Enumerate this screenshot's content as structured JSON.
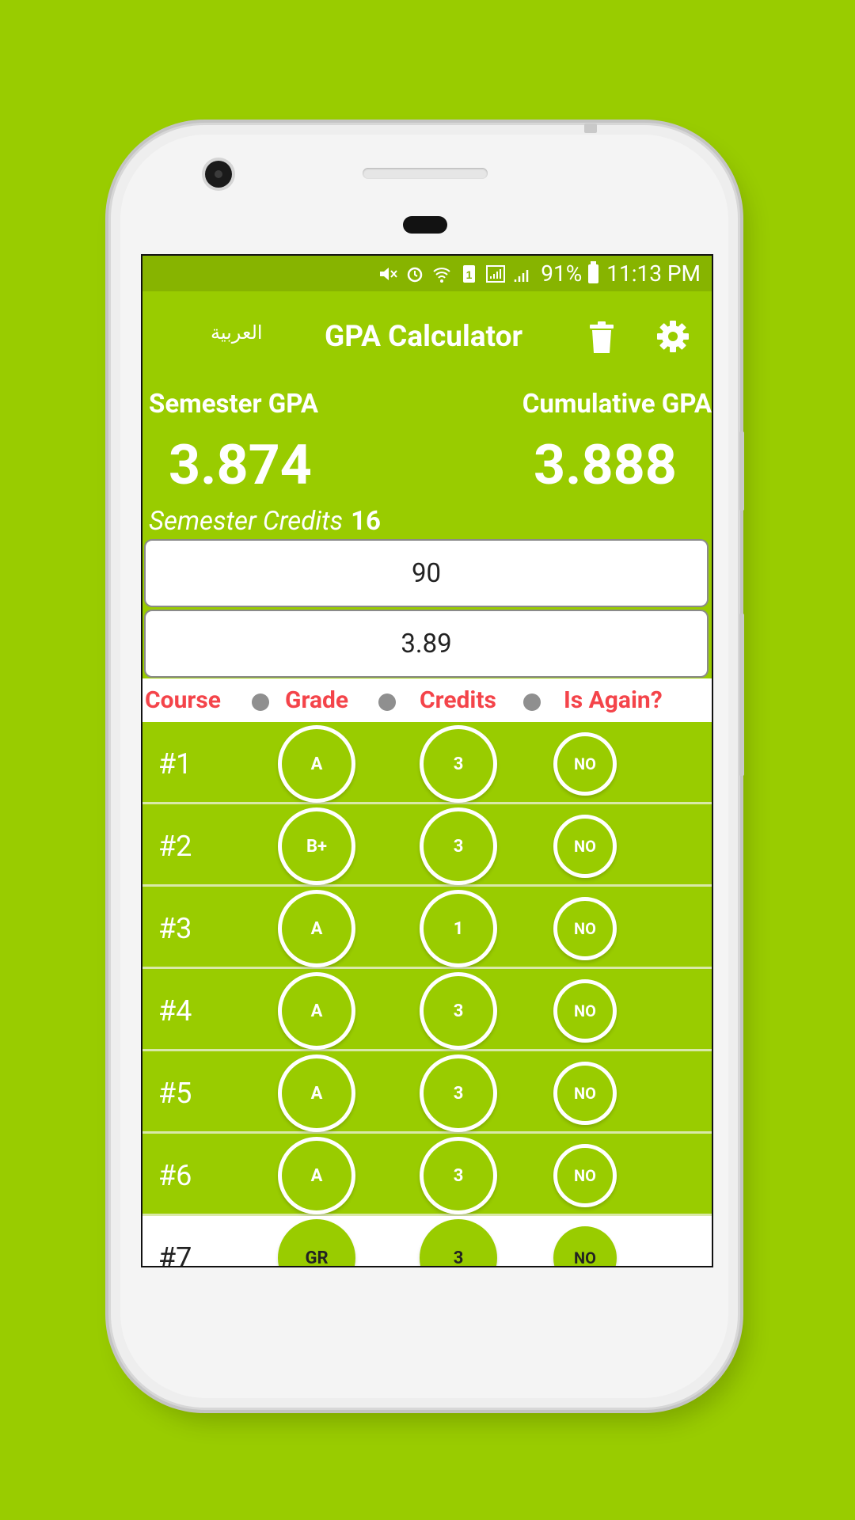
{
  "status_bar": {
    "battery": "91%",
    "time": "11:13 PM"
  },
  "toolbar": {
    "language": "العربية",
    "title": "GPA Calculator"
  },
  "summary": {
    "semester_label": "Semester GPA",
    "semester_value": "3.874",
    "cumulative_label": "Cumulative GPA",
    "cumulative_value": "3.888",
    "credits_label": "Semester Credits",
    "credits_value": "16"
  },
  "inputs": {
    "previous_credits": "90",
    "previous_gpa": "3.89"
  },
  "table": {
    "headers": [
      "Course",
      "Grade",
      "Credits",
      "Is Again?"
    ],
    "rows": [
      {
        "course": "#1",
        "grade": "A",
        "credits": "3",
        "again": "NO"
      },
      {
        "course": "#2",
        "grade": "B+",
        "credits": "3",
        "again": "NO"
      },
      {
        "course": "#3",
        "grade": "A",
        "credits": "1",
        "again": "NO"
      },
      {
        "course": "#4",
        "grade": "A",
        "credits": "3",
        "again": "NO"
      },
      {
        "course": "#5",
        "grade": "A",
        "credits": "3",
        "again": "NO"
      },
      {
        "course": "#6",
        "grade": "A",
        "credits": "3",
        "again": "NO"
      },
      {
        "course": "#7",
        "grade": "GR",
        "credits": "3",
        "again": "NO"
      }
    ]
  },
  "colors": {
    "accent": "#99cc00",
    "status": "#87b400",
    "header_text": "#f4444a"
  }
}
